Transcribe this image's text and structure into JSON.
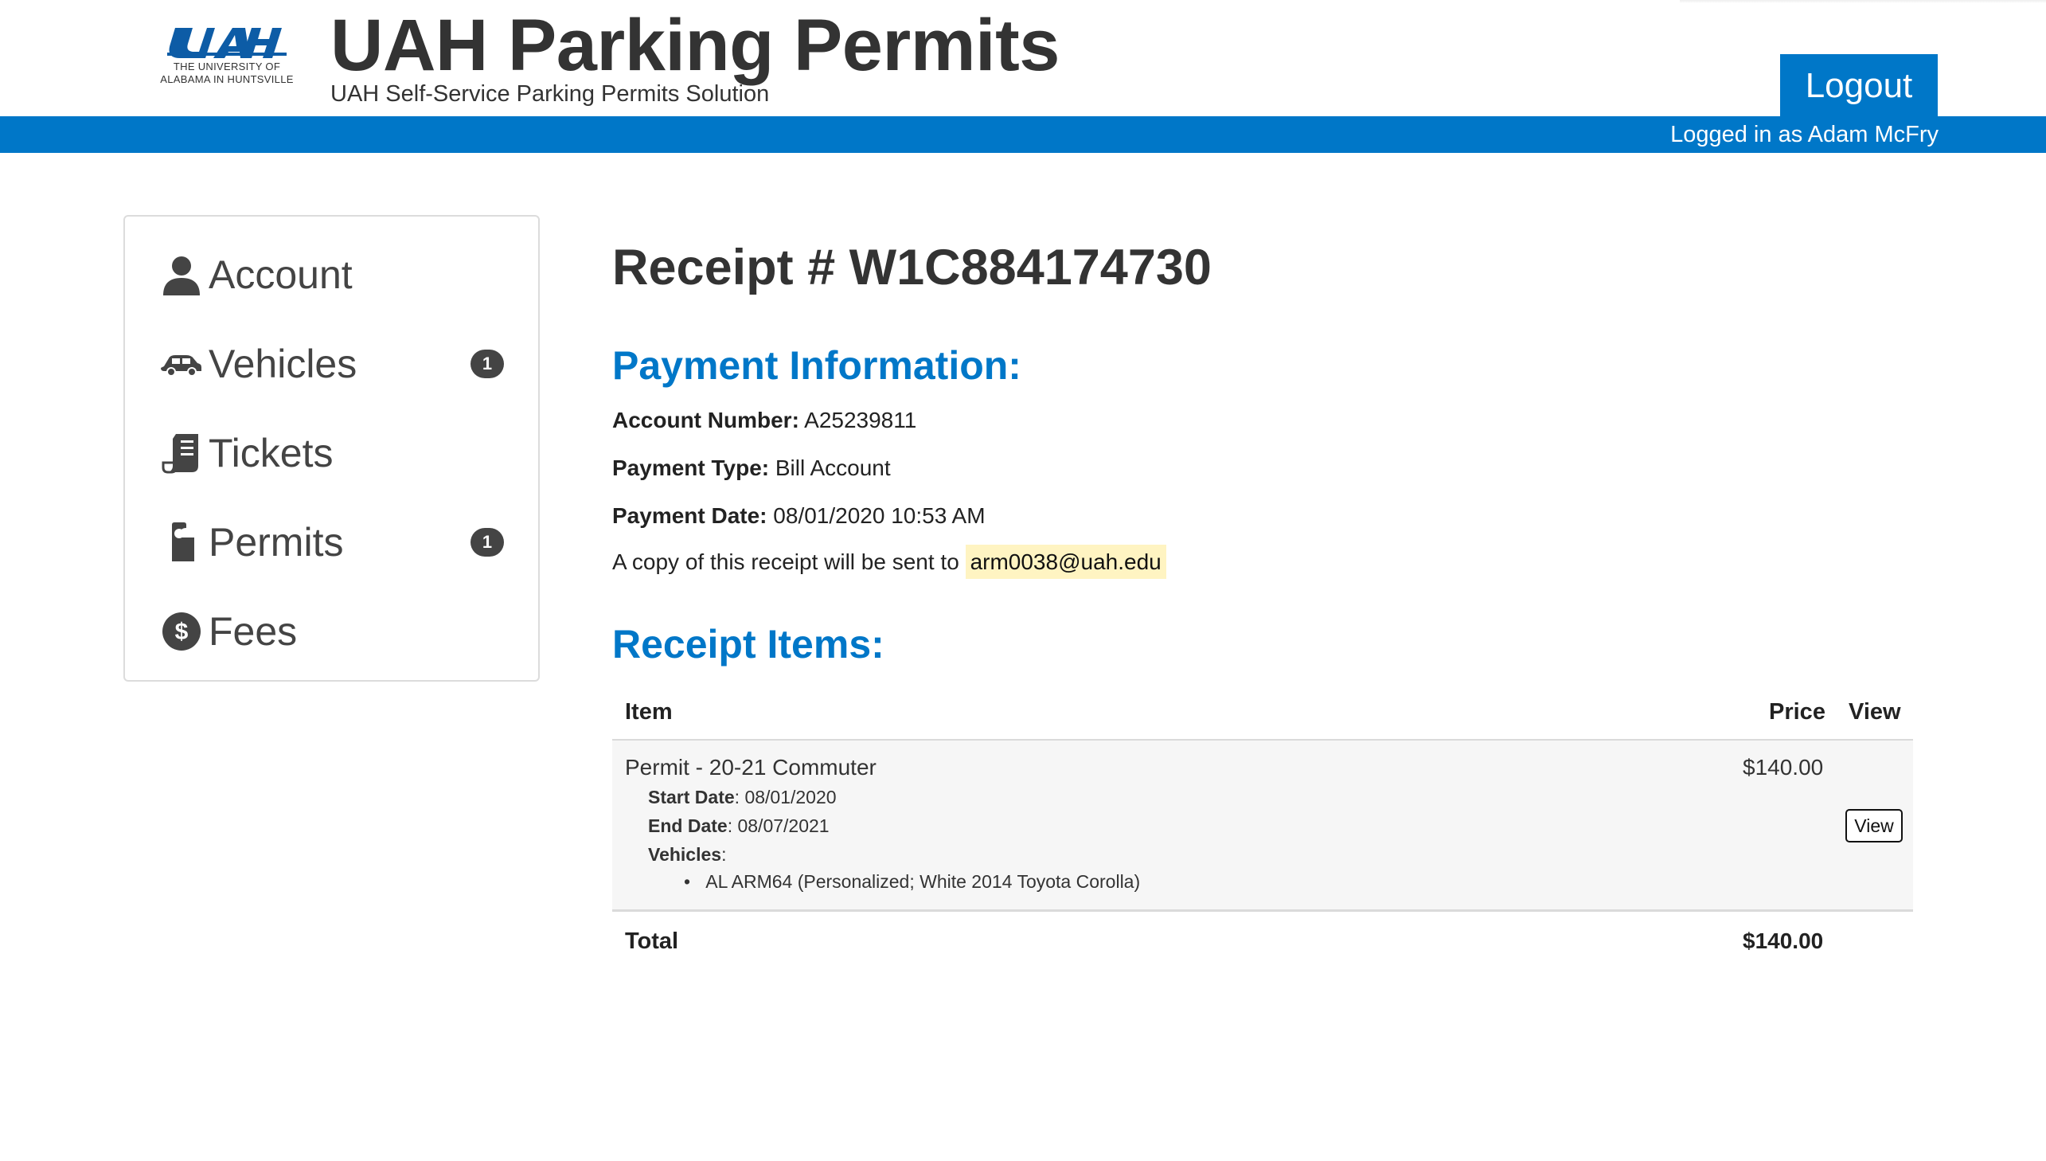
{
  "header": {
    "logo_text": "UAH",
    "logo_sub_line1": "THE UNIVERSITY OF",
    "logo_sub_line2": "ALABAMA IN HUNTSVILLE",
    "title": "UAH Parking Permits",
    "subtitle": "UAH Self-Service Parking Permits Solution",
    "logout_label": "Logout",
    "logged_in_text": "Logged in as Adam McFry",
    "brand_color": "#0077c8"
  },
  "sidebar": {
    "items": [
      {
        "label": "Account",
        "icon": "user-icon"
      },
      {
        "label": "Vehicles",
        "icon": "car-icon",
        "badge": "1"
      },
      {
        "label": "Tickets",
        "icon": "ticket-icon"
      },
      {
        "label": "Permits",
        "icon": "hang-tag-icon",
        "badge": "1"
      },
      {
        "label": "Fees",
        "icon": "dollar-circle-icon"
      }
    ]
  },
  "receipt": {
    "title": "Receipt # W1C884174730",
    "payment_heading": "Payment Information:",
    "account_number_label": "Account Number:",
    "account_number": "A25239811",
    "payment_type_label": "Payment Type:",
    "payment_type": "Bill Account",
    "payment_date_label": "Payment Date:",
    "payment_date": "08/01/2020 10:53 AM",
    "copy_text": "A copy of this receipt will be sent to",
    "email": "arm0038@uah.edu",
    "items_heading": "Receipt Items:",
    "table": {
      "headers": {
        "item": "Item",
        "price": "Price",
        "view": "View"
      },
      "rows": [
        {
          "item": "Permit - 20-21 Commuter",
          "start_label": "Start Date",
          "start_date": "08/01/2020",
          "end_label": "End Date",
          "end_date": "08/07/2021",
          "vehicles_label": "Vehicles",
          "vehicles": [
            "AL ARM64 (Personalized; White 2014 Toyota Corolla)"
          ],
          "price": "$140.00",
          "view_label": "View"
        }
      ],
      "total_label": "Total",
      "total": "$140.00"
    }
  }
}
